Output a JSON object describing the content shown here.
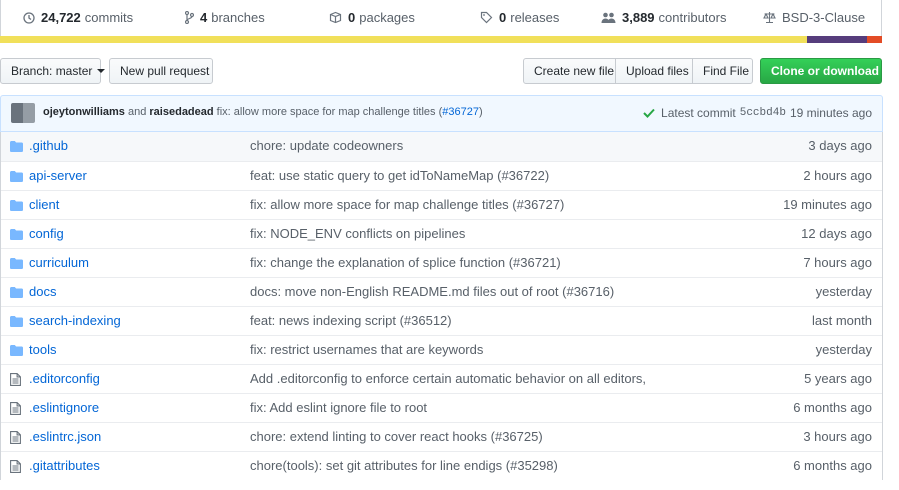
{
  "stats": [
    {
      "icon": "history-icon",
      "num": "24,722",
      "label": "commits"
    },
    {
      "icon": "branch-icon",
      "num": "4",
      "label": "branches"
    },
    {
      "icon": "package-icon",
      "num": "0",
      "label": "packages"
    },
    {
      "icon": "tag-icon",
      "num": "0",
      "label": "releases"
    },
    {
      "icon": "people-icon",
      "num": "3,889",
      "label": "contributors"
    },
    {
      "icon": "law-icon",
      "num": "",
      "label": "BSD-3-Clause"
    }
  ],
  "langbar_colors": [
    "#f1e05a",
    "#563d7c",
    "#e34c26"
  ],
  "toolbar": {
    "branch_label": "Branch: master",
    "new_pr": "New pull request",
    "create_file": "Create new file",
    "upload_files": "Upload files",
    "find_file": "Find File",
    "clone": "Clone or download"
  },
  "commit": {
    "author1": "ojeytonwilliams",
    "and": "and",
    "author2": "raisedadead",
    "message": "fix: allow more space for map challenge titles (",
    "pr_link": "#36727",
    "close": ")",
    "latest_label": "Latest commit",
    "sha": "5ccbd4b",
    "time": "19 minutes ago"
  },
  "files": [
    {
      "type": "dir",
      "name": ".github",
      "msg": "chore: update codeowners",
      "age": "3 days ago"
    },
    {
      "type": "dir",
      "name": "api-server",
      "msg": "feat: use static query to get idToNameMap (#36722)",
      "age": "2 hours ago"
    },
    {
      "type": "dir",
      "name": "client",
      "msg": "fix: allow more space for map challenge titles (#36727)",
      "age": "19 minutes ago"
    },
    {
      "type": "dir",
      "name": "config",
      "msg": "fix: NODE_ENV conflicts on pipelines",
      "age": "12 days ago"
    },
    {
      "type": "dir",
      "name": "curriculum",
      "msg": "fix: change the explanation of splice function (#36721)",
      "age": "7 hours ago"
    },
    {
      "type": "dir",
      "name": "docs",
      "msg": "docs: move non-English README.md files out of root (#36716)",
      "age": "yesterday"
    },
    {
      "type": "dir",
      "name": "search-indexing",
      "msg": "feat: news indexing script (#36512)",
      "age": "last month"
    },
    {
      "type": "dir",
      "name": "tools",
      "msg": "fix: restrict usernames that are keywords",
      "age": "yesterday"
    },
    {
      "type": "file",
      "name": ".editorconfig",
      "msg": "Add .editorconfig to enforce certain automatic behavior on all editors,",
      "age": "5 years ago"
    },
    {
      "type": "file",
      "name": ".eslintignore",
      "msg": "fix: Add eslint ignore file to root",
      "age": "6 months ago"
    },
    {
      "type": "file",
      "name": ".eslintrc.json",
      "msg": "chore: extend linting to cover react hooks (#36725)",
      "age": "3 hours ago"
    },
    {
      "type": "file",
      "name": ".gitattributes",
      "msg": "chore(tools): set git attributes for line endigs (#35298)",
      "age": "6 months ago"
    }
  ]
}
